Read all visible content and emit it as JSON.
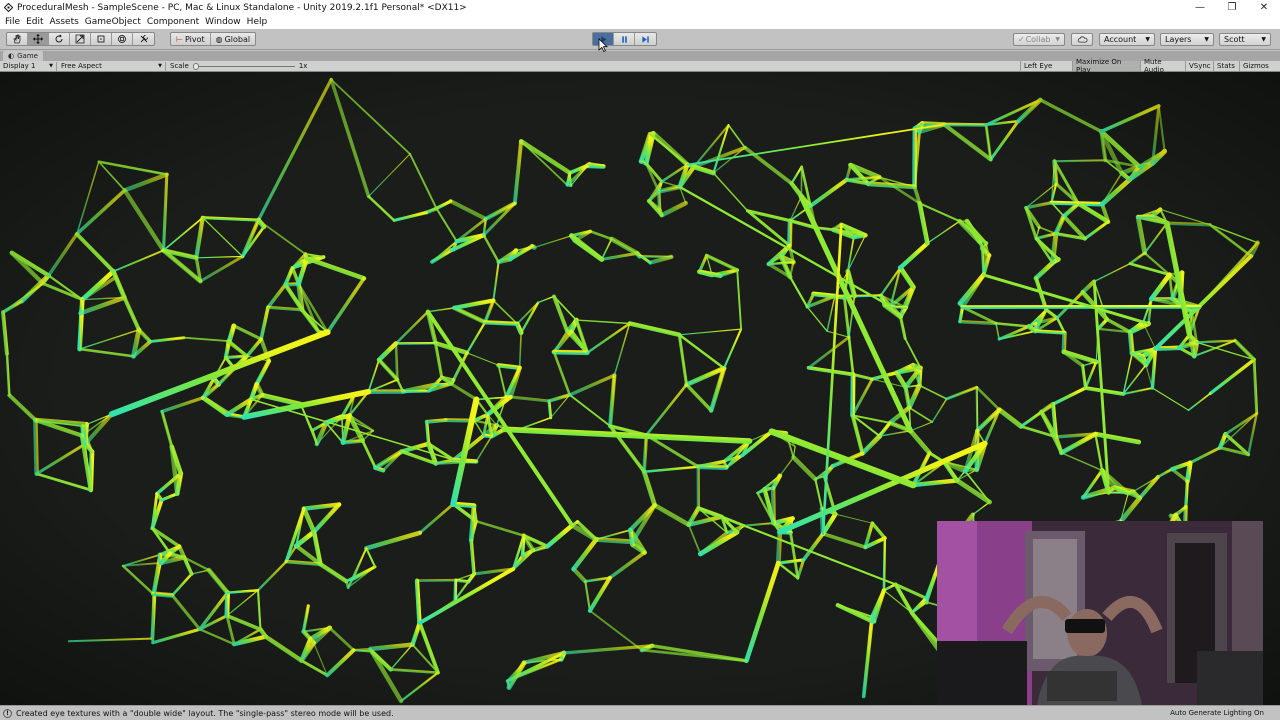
{
  "window": {
    "title": "ProceduralMesh - SampleScene - PC, Mac & Linux Standalone - Unity 2019.2.1f1 Personal* <DX11>",
    "minimize": "—",
    "maximize": "❐",
    "close": "✕"
  },
  "menu": [
    "File",
    "Edit",
    "Assets",
    "GameObject",
    "Component",
    "Window",
    "Help"
  ],
  "toolbar": {
    "pivot_label": "Pivot",
    "global_label": "Global",
    "collab_label": "Collab",
    "account_label": "Account",
    "layers_label": "Layers",
    "layout_label": "Scott"
  },
  "game_view": {
    "tab_label": "Game",
    "display_label": "Display 1",
    "aspect_label": "Free Aspect",
    "scale_label": "Scale",
    "scale_value": "1x",
    "toggles": [
      "Left Eye",
      "Maximize On Play",
      "Mute Audio",
      "VSync",
      "Stats",
      "Gizmos"
    ]
  },
  "status": {
    "message": "Created eye textures with a \"double wide\" layout.  The \"single-pass\" stereo mode will be used.",
    "right_text": "Auto Generate Lighting On"
  },
  "colors": {
    "mesh_yellow": "#e8f31a",
    "mesh_green": "#7ee83a",
    "mesh_teal": "#2fe3b0",
    "viewport_bg": "#1a1d19",
    "play_active": "#4a6f9e"
  }
}
